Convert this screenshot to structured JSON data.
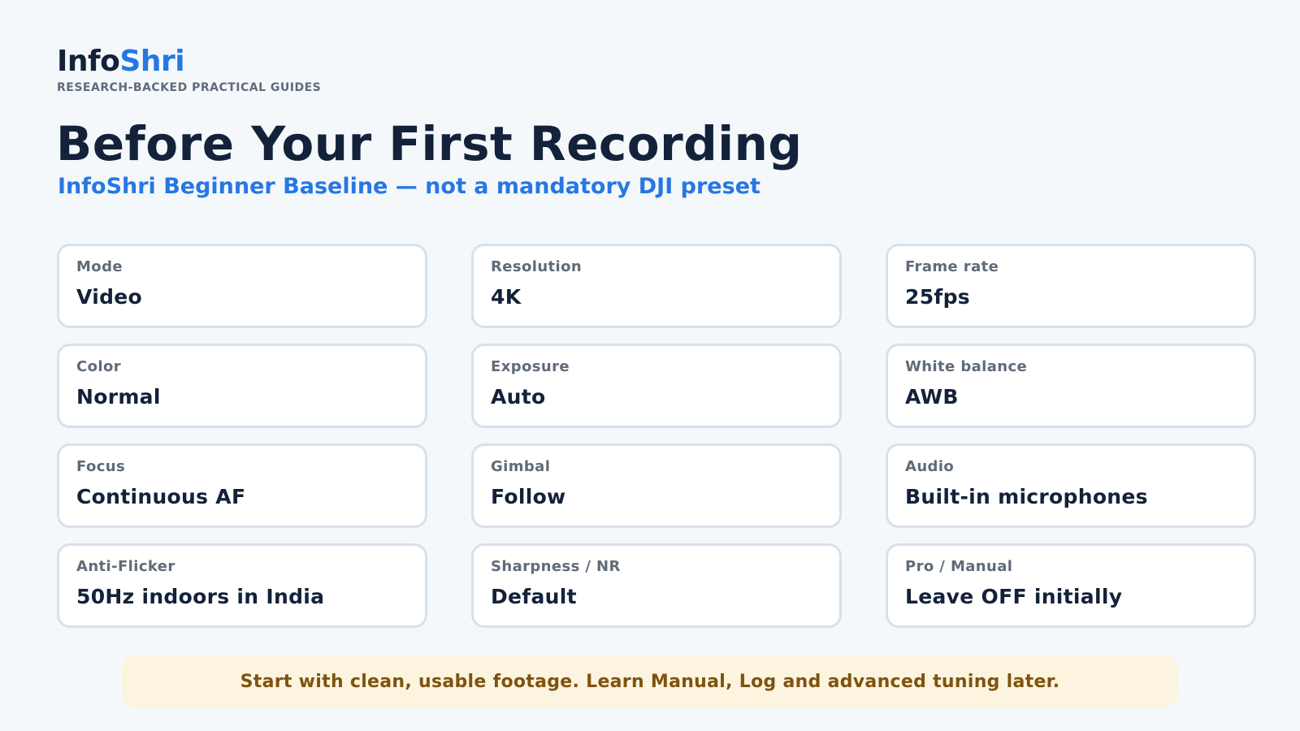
{
  "brand": {
    "part1": "Info",
    "part2": "Shri",
    "tagline": "RESEARCH-BACKED PRACTICAL GUIDES"
  },
  "title": "Before Your First Recording",
  "subtitle": "InfoShri Beginner Baseline — not a mandatory DJI preset",
  "settings": [
    {
      "label": "Mode",
      "value": "Video"
    },
    {
      "label": "Resolution",
      "value": "4K"
    },
    {
      "label": "Frame rate",
      "value": "25fps"
    },
    {
      "label": "Color",
      "value": "Normal"
    },
    {
      "label": "Exposure",
      "value": "Auto"
    },
    {
      "label": "White balance",
      "value": "AWB"
    },
    {
      "label": "Focus",
      "value": "Continuous AF"
    },
    {
      "label": "Gimbal",
      "value": "Follow"
    },
    {
      "label": "Audio",
      "value": "Built-in microphones"
    },
    {
      "label": "Anti-Flicker",
      "value": "50Hz indoors in India"
    },
    {
      "label": "Sharpness / NR",
      "value": "Default"
    },
    {
      "label": "Pro / Manual",
      "value": "Leave OFF initially"
    }
  ],
  "note": "Start with clean, usable footage. Learn Manual, Log and advanced tuning later.",
  "colors": {
    "background": "#f4f8fb",
    "ink": "#13223a",
    "accent": "#2777e3",
    "muted": "#606b79",
    "card_border": "#d8e1ea",
    "note_bg": "#fdf4df",
    "note_text": "#7e5310"
  }
}
